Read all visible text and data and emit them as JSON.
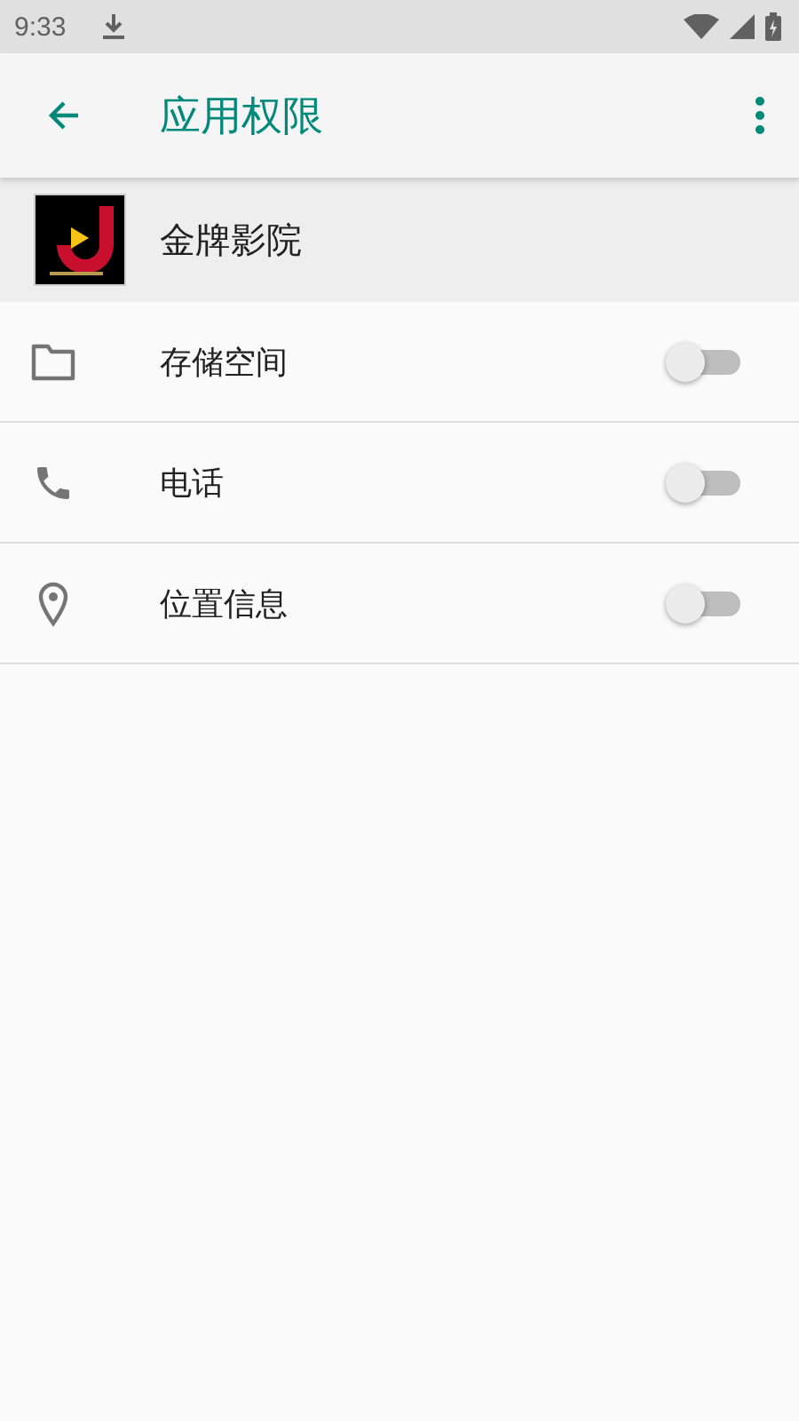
{
  "status_bar": {
    "time": "9:33"
  },
  "toolbar": {
    "title": "应用权限"
  },
  "app": {
    "name": "金牌影院"
  },
  "permissions": [
    {
      "kind": "storage",
      "label": "存储空间",
      "on": false
    },
    {
      "kind": "phone",
      "label": "电话",
      "on": false
    },
    {
      "kind": "location",
      "label": "位置信息",
      "on": false
    }
  ]
}
